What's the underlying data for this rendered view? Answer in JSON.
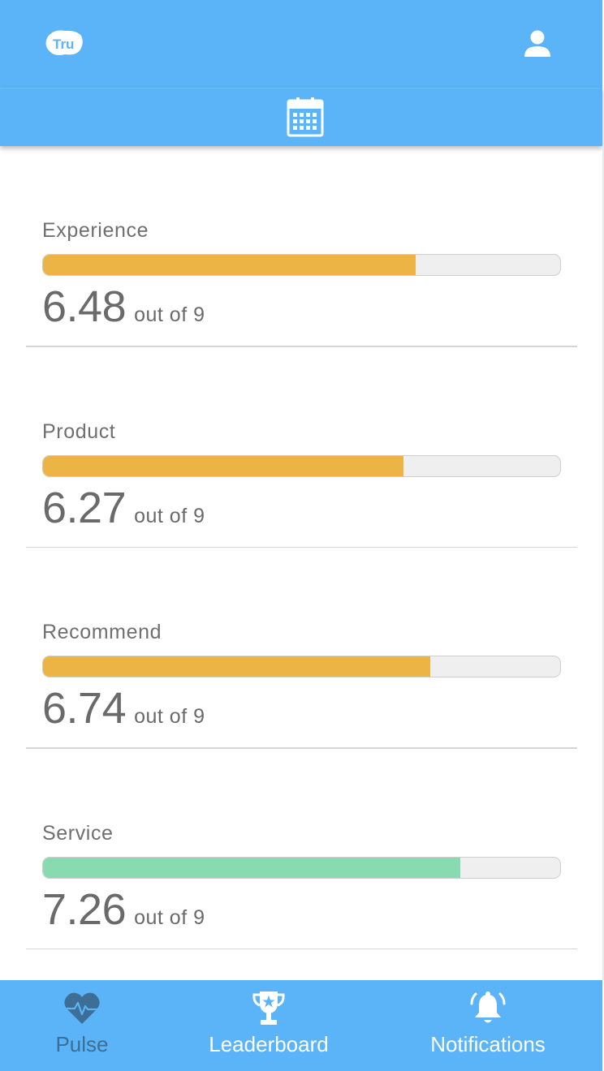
{
  "header": {
    "logo_text": "Tru",
    "profile_icon": "user-icon",
    "calendar_icon": "calendar-icon"
  },
  "metrics": [
    {
      "label": "Experience",
      "value": "6.48",
      "suffix": "out of 9",
      "fill_fraction": 0.72,
      "color": "#ecb444"
    },
    {
      "label": "Product",
      "value": "6.27",
      "suffix": "out of 9",
      "fill_fraction": 0.697,
      "color": "#ecb444"
    },
    {
      "label": "Recommend",
      "value": "6.74",
      "suffix": "out of 9",
      "fill_fraction": 0.749,
      "color": "#ecb444"
    },
    {
      "label": "Service",
      "value": "7.26",
      "suffix": "out of 9",
      "fill_fraction": 0.807,
      "color": "#88dbb0"
    }
  ],
  "nav": {
    "pulse_label": "Pulse",
    "leaderboard_label": "Leaderboard",
    "notifications_label": "Notifications",
    "active": "pulse"
  },
  "colors": {
    "primary": "#5ab4f7",
    "active_nav": "#3d6e96",
    "warning_fill": "#ecb444",
    "good_fill": "#88dbb0"
  }
}
